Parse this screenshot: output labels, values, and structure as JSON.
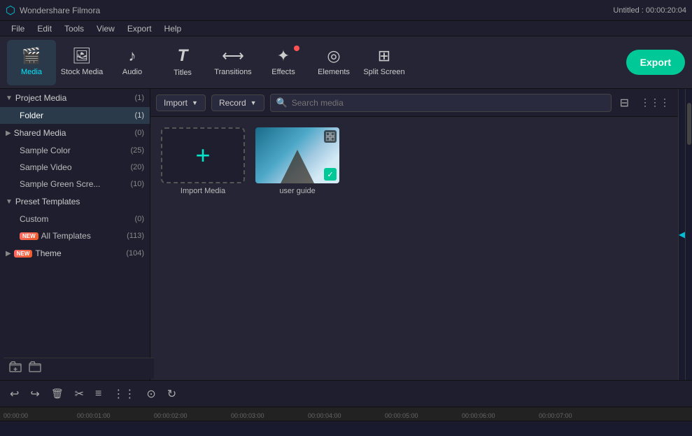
{
  "app": {
    "name": "Wondershare Filmora",
    "title_right": "Untitled : 00:00:20:04"
  },
  "menu": {
    "items": [
      "File",
      "Edit",
      "Tools",
      "View",
      "Export",
      "Help"
    ]
  },
  "toolbar": {
    "export_label": "Export",
    "tools": [
      {
        "id": "media",
        "label": "Media",
        "icon": "🎬",
        "active": true,
        "badge": false
      },
      {
        "id": "stock-media",
        "label": "Stock Media",
        "icon": "🖼",
        "active": false,
        "badge": false
      },
      {
        "id": "audio",
        "label": "Audio",
        "icon": "🎵",
        "active": false,
        "badge": false
      },
      {
        "id": "titles",
        "label": "Titles",
        "icon": "T",
        "active": false,
        "badge": false
      },
      {
        "id": "transitions",
        "label": "Transitions",
        "icon": "⟷",
        "active": false,
        "badge": false
      },
      {
        "id": "effects",
        "label": "Effects",
        "icon": "✨",
        "active": false,
        "badge": true
      },
      {
        "id": "elements",
        "label": "Elements",
        "icon": "◎",
        "active": false,
        "badge": false
      },
      {
        "id": "split-screen",
        "label": "Split Screen",
        "icon": "⊞",
        "active": false,
        "badge": false
      }
    ]
  },
  "sidebar": {
    "project_media": {
      "label": "Project Media",
      "count": "(1)",
      "expanded": true
    },
    "folder": {
      "label": "Folder",
      "count": "(1)",
      "active": true
    },
    "shared_media": {
      "label": "Shared Media",
      "count": "(0)"
    },
    "sample_color": {
      "label": "Sample Color",
      "count": "(25)"
    },
    "sample_video": {
      "label": "Sample Video",
      "count": "(20)"
    },
    "sample_green": {
      "label": "Sample Green Scre...",
      "count": "(10)"
    },
    "preset_templates": {
      "label": "Preset Templates",
      "expanded": true
    },
    "custom": {
      "label": "Custom",
      "count": "(0)"
    },
    "all_templates": {
      "label": "All Templates",
      "count": "(113)",
      "new_badge": true
    },
    "theme": {
      "label": "Theme",
      "count": "(104)",
      "new_badge": true,
      "expanded": true
    }
  },
  "content_toolbar": {
    "import_label": "Import",
    "record_label": "Record",
    "search_placeholder": "Search media"
  },
  "media_items": [
    {
      "id": "import",
      "type": "import",
      "label": "Import Media"
    },
    {
      "id": "user_guide",
      "type": "video",
      "label": "user guide"
    }
  ],
  "timeline": {
    "ruler_marks": [
      "00:00:00",
      "00:00:01:00",
      "00:00:02:00",
      "00:00:03:00",
      "00:00:04:00",
      "00:00:05:00",
      "00:00:06:00",
      "00:00:07:00"
    ]
  },
  "icons": {
    "chevron_down": "▼",
    "chevron_right": "▶",
    "search": "🔍",
    "filter": "⊞",
    "undo": "↩",
    "redo": "↪",
    "delete": "🗑",
    "scissors": "✂",
    "plus": "+",
    "check": "✓",
    "grid": "⋮⋮⋮"
  }
}
